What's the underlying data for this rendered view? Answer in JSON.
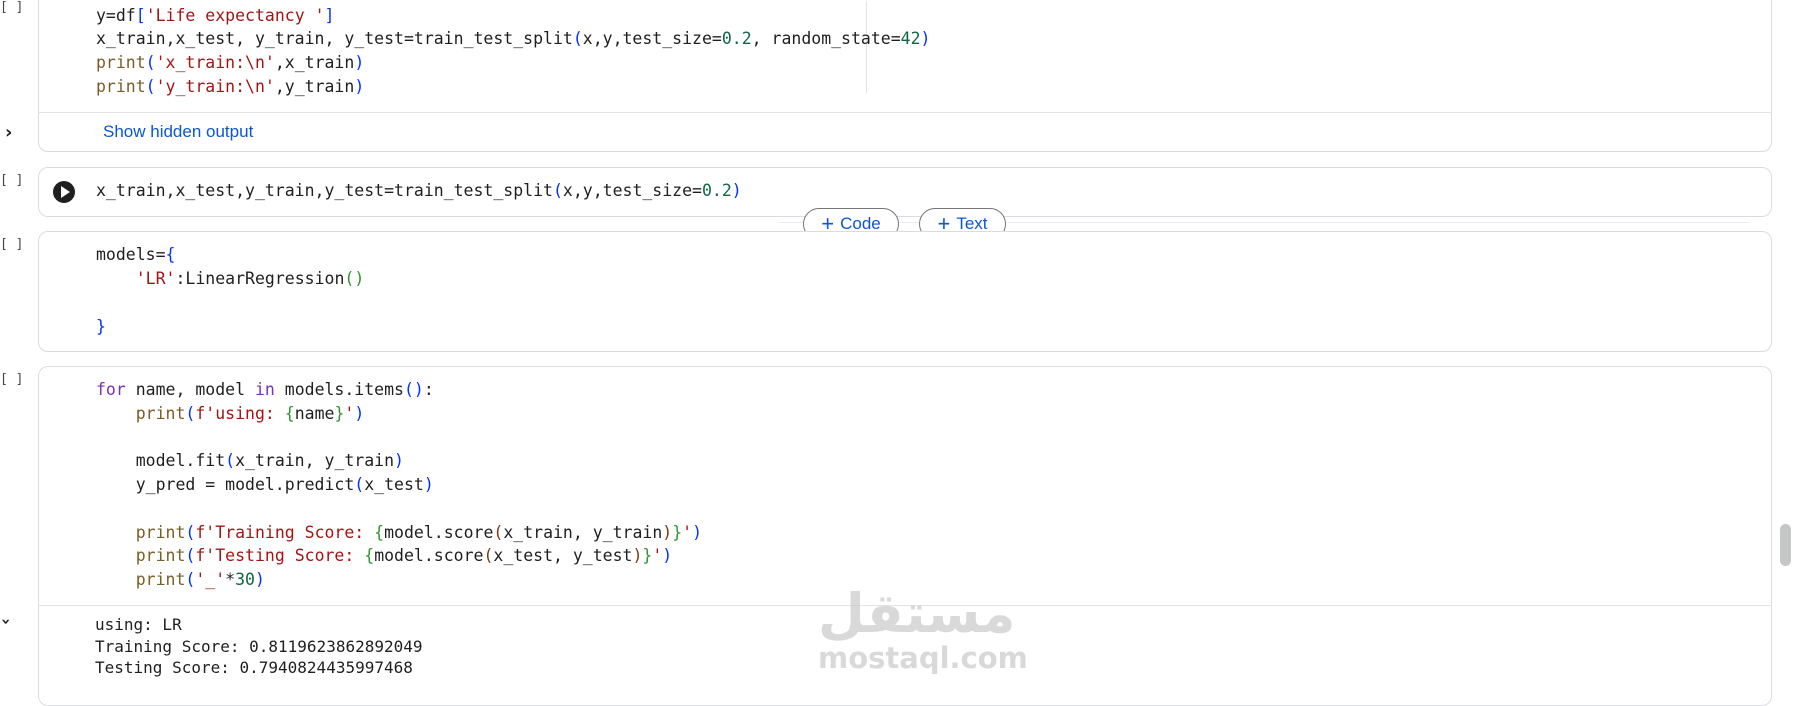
{
  "cells": [
    {
      "exec_count": "[ ]",
      "lines": [
        [
          "y=df",
          "['",
          "Life expectancy ",
          "']"
        ],
        [
          "x_train,x_test, y_train, y_test=train_test_split(x,y,test_size=0.2, random_state=42)"
        ],
        [
          "print('x_train:\\n',x_train)"
        ],
        [
          "print('y_train:\\n',y_train)"
        ]
      ],
      "hidden_output_label": "Show hidden output",
      "line_texts": {
        "l1": "y=df['Life expectancy ']",
        "l2": "x_train,x_test, y_train, y_test=train_test_split(x,y,test_size=0.2, random_state=42)",
        "l3": "print('x_train:\\n',x_train)",
        "l4": "print('y_train:\\n',y_train)"
      }
    },
    {
      "exec_count": "[ ]",
      "code": "x_train,x_test,y_train,y_test=train_test_split(x,y,test_size=0.2)"
    },
    {
      "exec_count": "[ ]",
      "code": "models={\n    'LR':LinearRegression()\n\n}"
    },
    {
      "exec_count": "[ ]",
      "code": "for name, model in models.items():\n    print(f'using: {name}')\n\n    model.fit(x_train, y_train)\n    y_pred = model.predict(x_test)\n\n    print(f'Training Score: {model.score(x_train, y_train)}')\n    print(f'Testing Score: {model.score(x_test, y_test)}')\n    print('_'*30)",
      "output_lines": [
        "using: LR",
        "Training Score: 0.8119623862892049",
        "Testing Score: 0.7940824435997468"
      ]
    }
  ],
  "add_buttons": {
    "code_label": "Code",
    "text_label": "Text",
    "plus": "+"
  },
  "icons": {
    "expand": "chevron-right-icon",
    "collapse": "chevron-down-icon",
    "run": "play-circle-icon"
  },
  "watermark": {
    "arabic": "مستقل",
    "latin": "mostaql.com"
  },
  "colors": {
    "link_blue": "#0b57d0",
    "string_red": "#a31515",
    "keyword_purple": "#7b30b5",
    "number_green": "#116644"
  }
}
